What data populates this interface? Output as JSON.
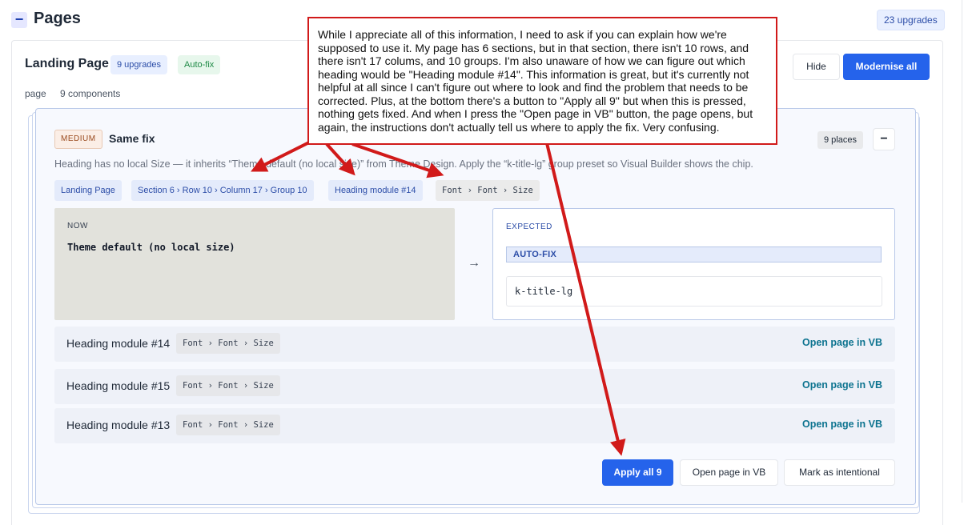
{
  "header": {
    "collapse_glyph": "−",
    "title": "Pages",
    "upgrades": "23 upgrades"
  },
  "group": {
    "title": "Landing Page",
    "upgrades_badge": "9 upgrades",
    "autofix_badge": "Auto-fix",
    "type": "page",
    "components": "9 components",
    "hide_label": "Hide",
    "modernise_label": "Modernise all"
  },
  "fix_card": {
    "severity": "MEDIUM",
    "title": "Same fix",
    "places": "9 places",
    "collapse_glyph": "−",
    "description": "Heading has no local Size — it inherits “Theme default (no local size)” from Theme Design. Apply the “k-title-lg” group preset so Visual Builder shows the chip.",
    "breadcrumb": [
      "Landing Page",
      "Section 6 › Row 10 › Column 17 › Group 10",
      "Heading module #14"
    ],
    "setting_path": "Font › Font › Size",
    "now_label": "NOW",
    "now_value": "Theme default (no local size)",
    "arrow": "→",
    "expected_label": "EXPECTED",
    "autofix_tag": "AUTO-FIX",
    "expected_value": "k-title-lg",
    "rows": [
      {
        "name": "Heading module #14",
        "path": "Font › Font › Size",
        "link": "Open page in VB"
      },
      {
        "name": "Heading module #15",
        "path": "Font › Font › Size",
        "link": "Open page in VB"
      },
      {
        "name": "Heading module #13",
        "path": "Font › Font › Size",
        "link": "Open page in VB"
      }
    ],
    "apply_label": "Apply all 9",
    "open_label": "Open page in VB",
    "intentional_label": "Mark as intentional"
  },
  "annotation": {
    "text": "While I appreciate all of this information, I need to ask if you can explain how we're supposed to use it. My page has 6 sections, but in that section, there isn't 10 rows, and there isn't 17 colums, and 10 groups. I'm also unaware of how we can figure out which heading would be \"Heading module #14\". This information is great, but it's currently not helpful at all since I can't figure out where to look and find the problem that needs to be corrected.  Plus, at the bottom there's a button to \"Apply all 9\" but when this is pressed, nothing gets fixed. And when I press the \"Open page in VB\" button, the page opens, but again, the instructions don't actually tell us where to apply the fix. Very confusing.",
    "color": "#d11a1a"
  },
  "colors": {
    "primary": "#2563eb",
    "link": "#0e7490",
    "severity": "#9a4b1f"
  }
}
